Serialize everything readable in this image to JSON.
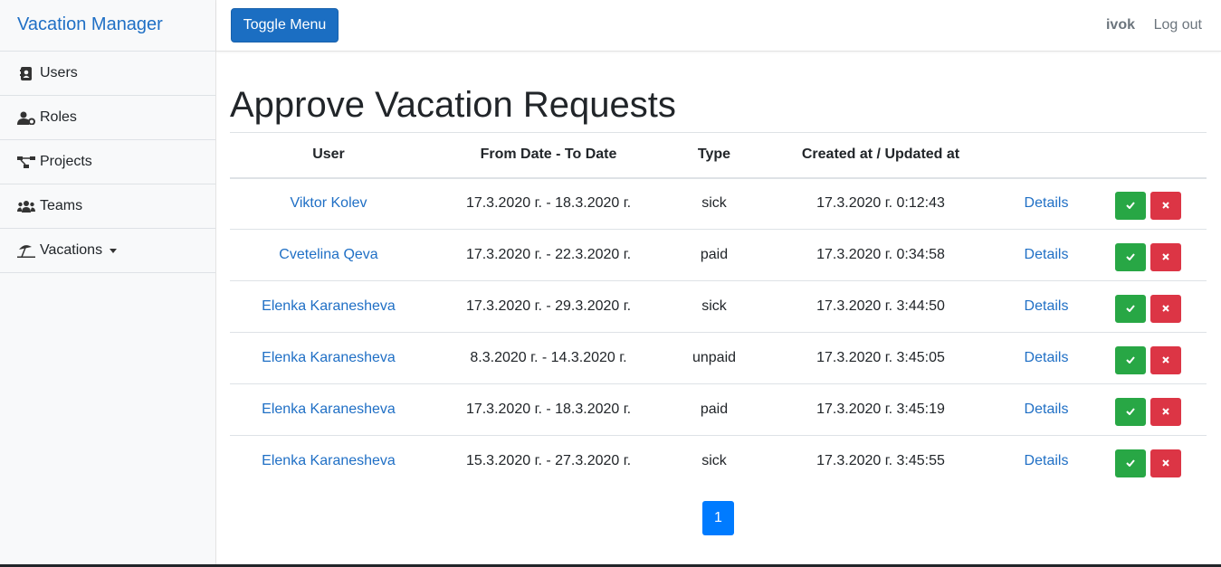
{
  "brand": "Vacation Manager",
  "sidebar": {
    "items": [
      {
        "label": "Users",
        "icon": "address-card-icon"
      },
      {
        "label": "Roles",
        "icon": "user-cog-icon"
      },
      {
        "label": "Projects",
        "icon": "project-diagram-icon"
      },
      {
        "label": "Teams",
        "icon": "users-icon"
      },
      {
        "label": "Vacations",
        "icon": "umbrella-beach-icon"
      }
    ]
  },
  "header": {
    "toggle_label": "Toggle Menu",
    "user": "ivok",
    "logout": "Log out"
  },
  "page": {
    "title": "Approve Vacation Requests"
  },
  "table": {
    "headers": [
      "User",
      "From Date - To Date",
      "Type",
      "Created at / Updated at",
      "",
      ""
    ],
    "rows": [
      {
        "user": "Viktor Kolev",
        "dates": "17.3.2020 г. - 18.3.2020 г.",
        "type": "sick",
        "created": "17.3.2020 г. 0:12:43",
        "details": "Details"
      },
      {
        "user": "Cvetelina Qeva",
        "dates": "17.3.2020 г. - 22.3.2020 г.",
        "type": "paid",
        "created": "17.3.2020 г. 0:34:58",
        "details": "Details"
      },
      {
        "user": "Elenka Karanesheva",
        "dates": "17.3.2020 г. - 29.3.2020 г.",
        "type": "sick",
        "created": "17.3.2020 г. 3:44:50",
        "details": "Details"
      },
      {
        "user": "Elenka Karanesheva",
        "dates": "8.3.2020 г. - 14.3.2020 г.",
        "type": "unpaid",
        "created": "17.3.2020 г. 3:45:05",
        "details": "Details"
      },
      {
        "user": "Elenka Karanesheva",
        "dates": "17.3.2020 г. - 18.3.2020 г.",
        "type": "paid",
        "created": "17.3.2020 г. 3:45:19",
        "details": "Details"
      },
      {
        "user": "Elenka Karanesheva",
        "dates": "15.3.2020 г. - 27.3.2020 г.",
        "type": "sick",
        "created": "17.3.2020 г. 3:45:55",
        "details": "Details"
      }
    ]
  },
  "pagination": {
    "current": "1"
  },
  "colors": {
    "accent": "#1b6ec2",
    "link": "#1f6fc5",
    "approve": "#28a745",
    "reject": "#dc3545",
    "page_active": "#007bff"
  }
}
